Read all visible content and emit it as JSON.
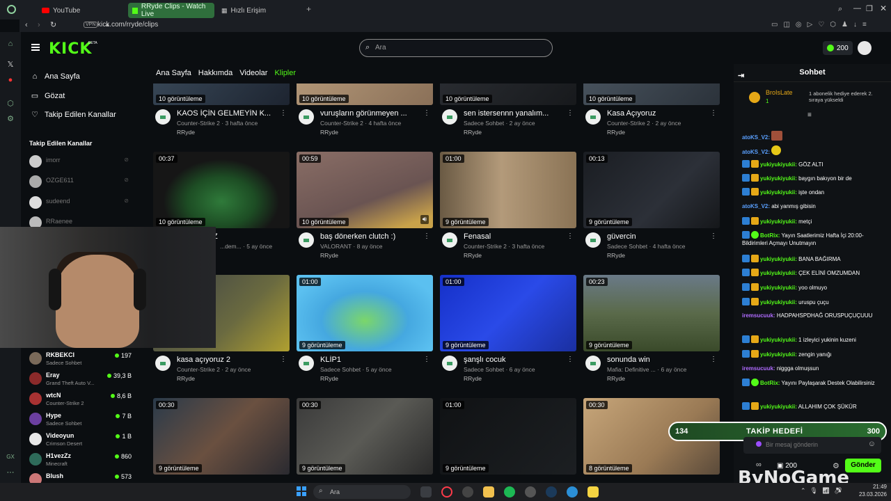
{
  "browser": {
    "tabs": [
      {
        "label": "YouTube"
      },
      {
        "label": "RRyde Clips - Watch Live"
      },
      {
        "label": "Hızlı Erişim"
      }
    ],
    "url": "kick.com/rryde/clips",
    "vpn": "VPN"
  },
  "header": {
    "logo": "KICK",
    "beta": "BETA",
    "search_placeholder": "Ara",
    "coins": "200"
  },
  "nav": {
    "main": [
      {
        "label": "Ana Sayfa",
        "icon": "home-icon"
      },
      {
        "label": "Gözat",
        "icon": "browse-icon"
      },
      {
        "label": "Takip Edilen Kanallar",
        "icon": "heart-icon"
      }
    ],
    "followed_heading": "Takip Edilen Kanallar",
    "followed": [
      {
        "name": "imorr"
      },
      {
        "name": "OZGE611"
      },
      {
        "name": "sudeend"
      },
      {
        "name": "RRaenee"
      }
    ],
    "streams": [
      {
        "name": "RKBEKCI",
        "category": "Sadece Sohbet",
        "viewers": "197"
      },
      {
        "name": "Eray",
        "category": "Grand Theft Auto V...",
        "viewers": "39,3 B"
      },
      {
        "name": "wtcN",
        "category": "Counter-Strike 2",
        "viewers": "8,6 B"
      },
      {
        "name": "Hype",
        "category": "Sadece Sohbet",
        "viewers": "7 B"
      },
      {
        "name": "Videoyun",
        "category": "Crimson Desert",
        "viewers": "1 B"
      },
      {
        "name": "H1vezZz",
        "category": "Minecraft",
        "viewers": "860"
      },
      {
        "name": "Blush",
        "category": "",
        "viewers": "573"
      }
    ]
  },
  "page_tabs": [
    {
      "label": "Ana Sayfa"
    },
    {
      "label": "Hakkımda"
    },
    {
      "label": "Videolar"
    },
    {
      "label": "Klipler"
    }
  ],
  "clips": [
    {
      "duration": "",
      "views": "10 görüntüleme",
      "title": "KAOS İÇİN GELMEYİN K...",
      "meta": "Counter-Strike 2 · 3 hafta önce",
      "user": "RRyde"
    },
    {
      "duration": "",
      "views": "10 görüntüleme",
      "title": "vuruşların görünmeyen ...",
      "meta": "Counter-Strike 2 · 4 hafta önce",
      "user": "RRyde"
    },
    {
      "duration": "",
      "views": "10 görüntüleme",
      "title": "sen istersennn yanalım...",
      "meta": "Sadece Sohbet · 2 ay önce",
      "user": "RRyde"
    },
    {
      "duration": "",
      "views": "10 görüntüleme",
      "title": "Kasa Açıyoruz",
      "meta": "Counter-Strike 2 · 2 ay önce",
      "user": "RRyde"
    },
    {
      "duration": "00:37",
      "views": "10 görüntüleme",
      "title": "Z",
      "meta": "...dem... · 5 ay önce",
      "user": ""
    },
    {
      "duration": "00:59",
      "views": "10 görüntüleme",
      "title": "baş dönerken clutch :)",
      "meta": "VALORANT · 8 ay önce",
      "user": "RRyde"
    },
    {
      "duration": "01:00",
      "views": "9 görüntüleme",
      "title": "Fenasal",
      "meta": "Counter-Strike 2 · 3 hafta önce",
      "user": "RRyde"
    },
    {
      "duration": "00:13",
      "views": "9 görüntüleme",
      "title": "güvercin",
      "meta": "Sadece Sohbet · 4 hafta önce",
      "user": "RRyde"
    },
    {
      "duration": "",
      "views": "",
      "title": "kasa açıyoruz 2",
      "meta": "Counter-Strike 2 · 2 ay önce",
      "user": "RRyde"
    },
    {
      "duration": "01:00",
      "views": "9 görüntüleme",
      "title": "KLİP1",
      "meta": "Sadece Sohbet · 5 ay önce",
      "user": "RRyde"
    },
    {
      "duration": "01:00",
      "views": "9 görüntüleme",
      "title": "şanşlı cocuk",
      "meta": "Sadece Sohbet · 6 ay önce",
      "user": "RRyde"
    },
    {
      "duration": "00:23",
      "views": "9 görüntüleme",
      "title": "sonunda win",
      "meta": "Mafia: Definitive ... · 6 ay önce",
      "user": "RRyde"
    },
    {
      "duration": "00:30",
      "views": "9 görüntüleme",
      "title": "",
      "meta": "",
      "user": ""
    },
    {
      "duration": "00:30",
      "views": "9 görüntüleme",
      "title": "",
      "meta": "",
      "user": ""
    },
    {
      "duration": "01:00",
      "views": "9 görüntüleme",
      "title": "",
      "meta": "",
      "user": ""
    },
    {
      "duration": "00:30",
      "views": "8 görüntüleme",
      "title": "",
      "meta": "",
      "user": ""
    }
  ],
  "chat": {
    "title": "Sohbet",
    "gift_user": "BroIsLate",
    "gift_count": "1",
    "gift_text": "1 abonelik hediye ederek 2. sıraya yükseldi",
    "messages": [
      {
        "user": "atoKS_V2:",
        "text": "",
        "color": "#5aa0ff"
      },
      {
        "user": "atoKS_V2:",
        "text": "",
        "color": "#5aa0ff"
      },
      {
        "user": "yukiyukiyukii:",
        "text": "GÖZ ALTI",
        "color": "#53fc18"
      },
      {
        "user": "yukiyukiyukii:",
        "text": "baygın bakıyon bir de",
        "color": "#53fc18"
      },
      {
        "user": "yukiyukiyukii:",
        "text": "işte ondan",
        "color": "#53fc18"
      },
      {
        "user": "atoKS_V2:",
        "text": "abi yanmış gibisin",
        "color": "#5aa0ff"
      },
      {
        "user": "yukiyukiyukii:",
        "text": "metçi",
        "color": "#53fc18"
      },
      {
        "user": "BotRix:",
        "text": "Yayın Saatlerimiz Hafta İçi 20:00-Bildirimleri Açmayı Unutmayın",
        "color": "#53fc18"
      },
      {
        "user": "yukiyukiyukii:",
        "text": "BANA BAĞIRMA",
        "color": "#53fc18"
      },
      {
        "user": "yukiyukiyukii:",
        "text": "ÇEK ELİNİ OMZUMDAN",
        "color": "#53fc18"
      },
      {
        "user": "yukiyukiyukii:",
        "text": "yoo olmuyo",
        "color": "#53fc18"
      },
      {
        "user": "yukiyukiyukii:",
        "text": "uruspu çuçu",
        "color": "#53fc18"
      },
      {
        "user": "iremsucuuk:",
        "text": "HADPAHSPDHAĞ ORUSPUÇUÇUUU",
        "color": "#b06bff"
      },
      {
        "user": "yukiyukiyukii:",
        "text": "1 izleyici yukinin kuzeni",
        "color": "#53fc18"
      },
      {
        "user": "yukiyukiyukii:",
        "text": "zengin yanığı",
        "color": "#53fc18"
      },
      {
        "user": "iremsucuuk:",
        "text": "niggga olmuşsun",
        "color": "#b06bff"
      },
      {
        "user": "BotRix:",
        "text": "Yayını Paylaşarak Destek Olabilirsiniz",
        "color": "#53fc18"
      },
      {
        "user": "yukiyukiyukii:",
        "text": "ALLAHIM ÇOK ŞÜKÜR",
        "color": "#53fc18"
      }
    ],
    "input_placeholder": "Bir mesaj gönderin",
    "coins": "200",
    "send_label": "Gönder"
  },
  "goal": {
    "current": "134",
    "label": "TAKİP HEDEFİ",
    "target": "300"
  },
  "watermark": "ByNoGame",
  "taskbar": {
    "search_placeholder": "Ara",
    "time": "21:49",
    "date": "23.03.2026"
  }
}
